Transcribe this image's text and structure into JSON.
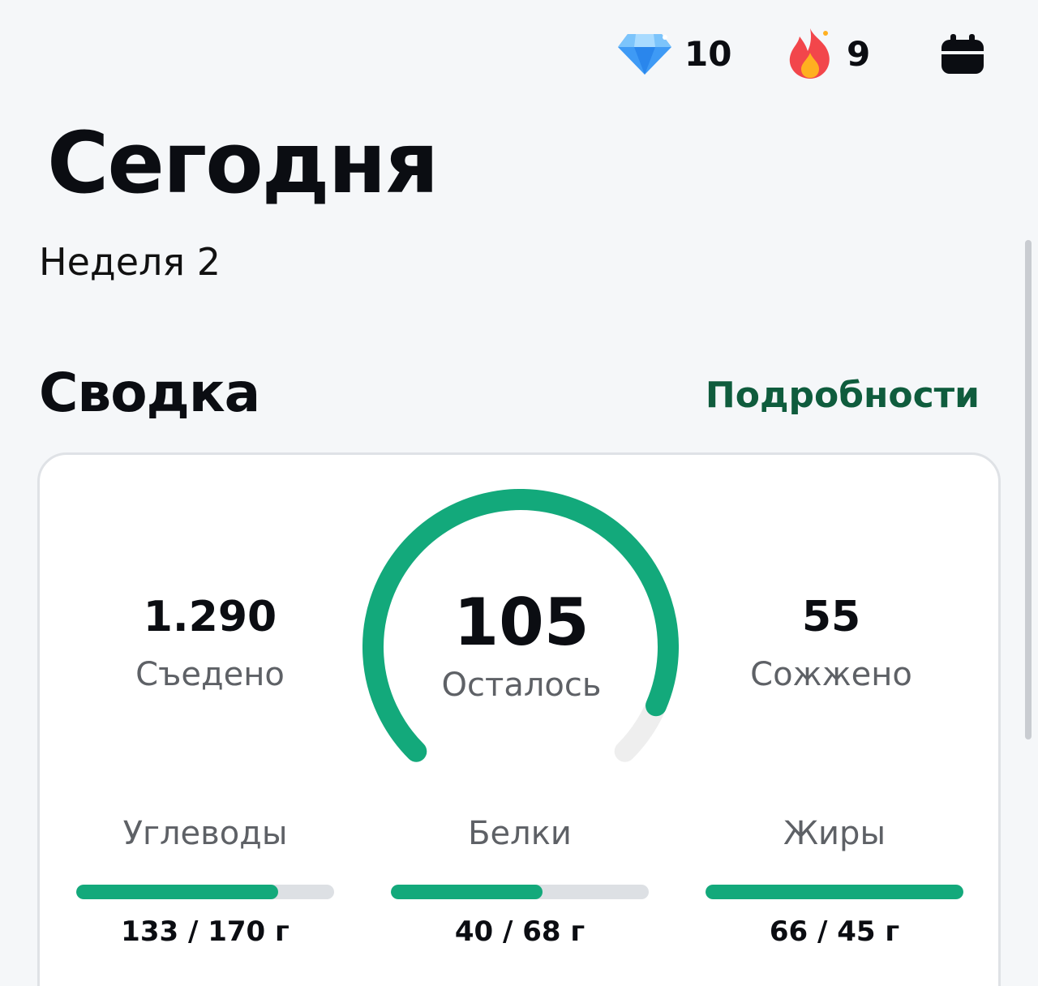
{
  "header": {
    "gems": {
      "icon": "diamond-icon",
      "value": "10"
    },
    "streak": {
      "icon": "fire-icon",
      "value": "9"
    },
    "calendar": {
      "icon": "calendar-icon"
    }
  },
  "title": "Сегодня",
  "subtitle": "Неделя 2",
  "summary": {
    "title": "Сводка",
    "details_label": "Подробности",
    "eaten": {
      "value": "1.290",
      "label": "Съедено"
    },
    "remaining": {
      "value": "105",
      "label": "Осталось",
      "progress": 0.92
    },
    "burned": {
      "value": "55",
      "label": "Сожжено"
    },
    "macros": [
      {
        "name": "Углеводы",
        "value": "133 / 170 г",
        "current": 133,
        "goal": 170
      },
      {
        "name": "Белки",
        "value": "40 / 68 г",
        "current": 40,
        "goal": 68
      },
      {
        "name": "Жиры",
        "value": "66 / 45 г",
        "current": 66,
        "goal": 45
      }
    ]
  },
  "colors": {
    "accent": "#13a97b",
    "link": "#0f5c3d",
    "track": "#dde0e4",
    "gauge_track": "#eeeeee"
  }
}
